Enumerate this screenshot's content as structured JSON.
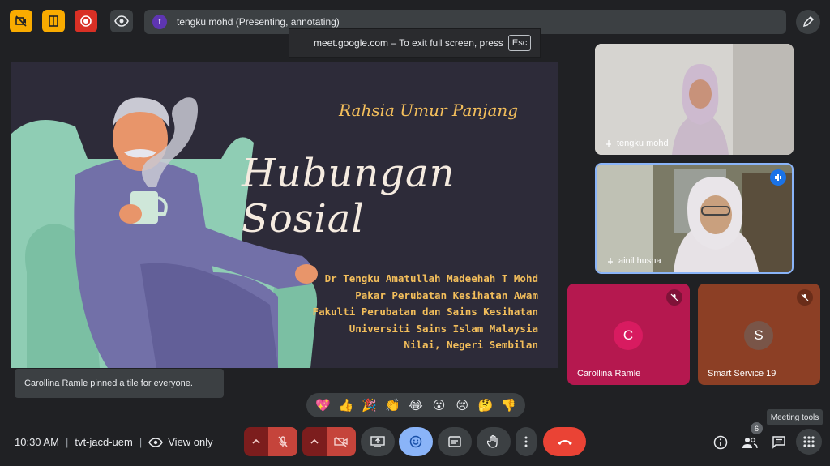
{
  "colors": {
    "yellow_btn": "#f9ab00",
    "record_red": "#d93025",
    "end_call_red": "#ea4335",
    "emoji_blue": "#8ab4f8",
    "mute_red": "#c5443b",
    "slide_bg": "#2d2b39",
    "slide_gold": "#f3be5b",
    "tile_magenta": "#b5184f",
    "tile_brown": "#8c3f25",
    "avatar_c": "#d81b60",
    "avatar_s": "#795548"
  },
  "top_bar": {
    "presenter_initial": "t",
    "presenting_text": "tengku mohd (Presenting, annotating)",
    "fullscreen_toast": "meet.google.com – To exit full screen, press",
    "esc_key": "Esc"
  },
  "slide": {
    "subtitle": "Rahsia Umur Panjang",
    "title": "Hubungan Sosial",
    "credits": [
      "Dr Tengku Amatullah Madeehah T Mohd",
      "Pakar Perubatan Kesihatan Awam",
      "Fakulti Perubatan dan Sains Kesihatan",
      "Universiti Sains Islam Malaysia",
      "Nilai, Negeri Sembilan"
    ]
  },
  "participants": [
    {
      "name": "tengku mohd"
    },
    {
      "name": "ainil husna"
    },
    {
      "name": "Carollina Ramle",
      "initial": "C"
    },
    {
      "name": "Smart Service 19",
      "initial": "S"
    }
  ],
  "pin_toast": "Carollina Ramle pinned a tile for everyone.",
  "reactions": [
    "💖",
    "👍",
    "🎉",
    "👏",
    "😂",
    "😮",
    "😢",
    "🤔",
    "👎"
  ],
  "bottom_bar": {
    "time": "10:30 AM",
    "meeting_code": "tvt-jacd-uem",
    "view_mode": "View only",
    "tooltip": "Meeting tools",
    "participant_count": "6"
  }
}
